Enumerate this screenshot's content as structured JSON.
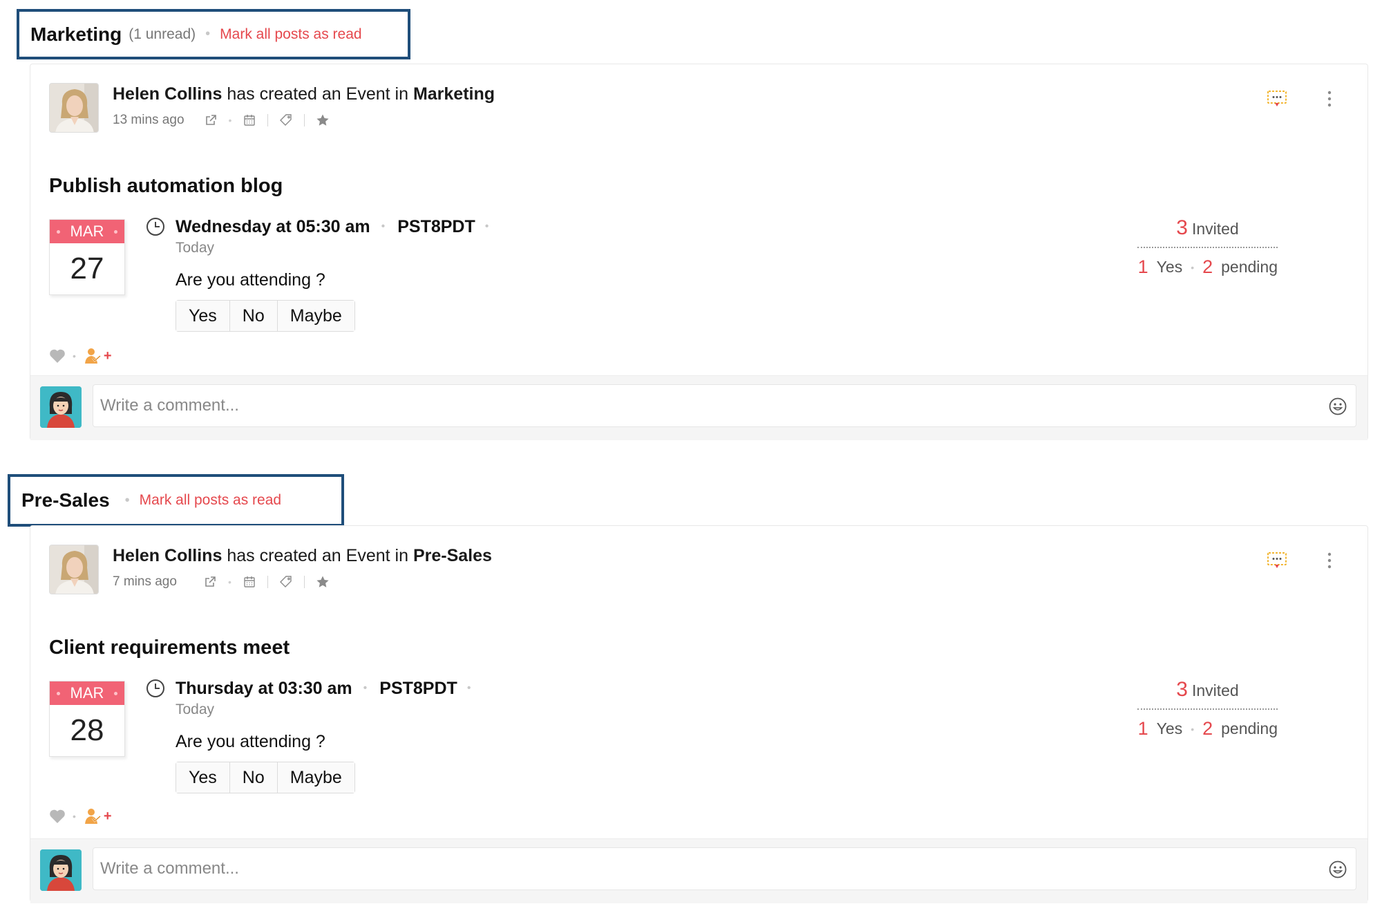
{
  "groups": [
    {
      "name": "Marketing",
      "unread": "(1 unread)",
      "mark_read": "Mark all posts as read",
      "post": {
        "author": "Helen Collins",
        "action": " has created an Event in ",
        "group": "Marketing",
        "time_ago": "13 mins ago",
        "event_title": "Publish automation blog",
        "cal_month": "MAR",
        "cal_day": "27",
        "when": "Wednesday at 05:30 am",
        "timezone": "PST8PDT",
        "when_sub": "Today",
        "question": "Are you attending ?",
        "rsvp": [
          "Yes",
          "No",
          "Maybe"
        ],
        "invited_count": "3",
        "invited_label": "Invited",
        "yes_count": "1",
        "yes_label": "Yes",
        "pending_count": "2",
        "pending_label": "pending",
        "comment_placeholder": "Write a comment...",
        "add_reaction": "+"
      }
    },
    {
      "name": "Pre-Sales",
      "mark_read": "Mark all posts as read",
      "post": {
        "author": "Helen Collins",
        "action": " has created an Event in ",
        "group": "Pre-Sales",
        "time_ago": "7 mins ago",
        "event_title": "Client requirements meet",
        "cal_month": "MAR",
        "cal_day": "28",
        "when": "Thursday at 03:30 am",
        "timezone": "PST8PDT",
        "when_sub": "Today",
        "question": "Are you attending ?",
        "rsvp": [
          "Yes",
          "No",
          "Maybe"
        ],
        "invited_count": "3",
        "invited_label": "Invited",
        "yes_count": "1",
        "yes_label": "Yes",
        "pending_count": "2",
        "pending_label": "pending",
        "comment_placeholder": "Write a comment...",
        "add_reaction": "+"
      }
    }
  ],
  "icons": {
    "post_meta": [
      "external-link-icon",
      "calendar-icon",
      "tag-icon",
      "star-icon"
    ],
    "post_actions": [
      "comment-bubble-icon",
      "more-vertical-icon"
    ],
    "reactions": [
      "heart-icon",
      "add-user-icon"
    ],
    "comment": [
      "emoji-icon"
    ]
  },
  "colors": {
    "accent_red": "#e5484d",
    "calendar_header": "#f16375",
    "group_frame": "#1f4e7a"
  }
}
